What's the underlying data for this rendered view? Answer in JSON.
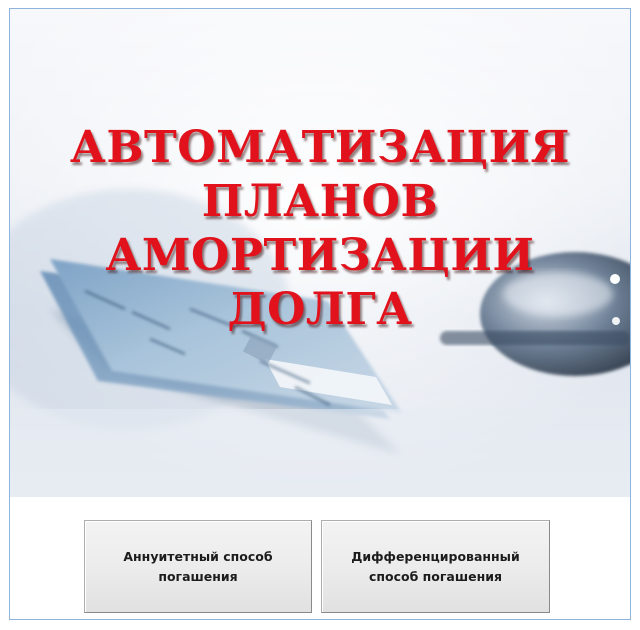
{
  "banner": {
    "title_lines": [
      "АВТОМАТИЗАЦИЯ",
      "ПЛАНОВ",
      "АМОРТИЗАЦИИ",
      "ДОЛГА"
    ],
    "title_color": "#e1121b",
    "image_subject": "credit-card-and-glasses"
  },
  "buttons": {
    "annuity_label": "Аннуитетный способ погашения",
    "differentiated_label": "Дифференцированный способ погашения"
  },
  "colors": {
    "frame_border": "#8eb4dd",
    "button_bg": "#ececec"
  }
}
